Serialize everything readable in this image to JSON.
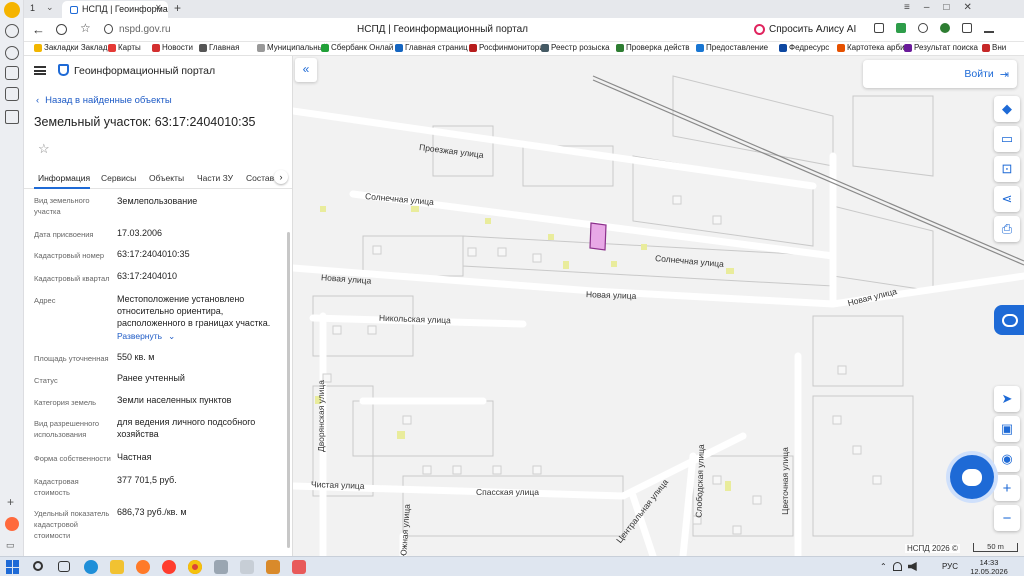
{
  "browser": {
    "tab_count": "1",
    "active_tab_title": "НСПД | Геоинформац",
    "new_tab": "+",
    "url": "nspd.gov.ru",
    "page_title": "НСПД | Геоинформационный портал",
    "alice_label": "Спросить Алису AI",
    "bookmarks": [
      "Закладки Закладк",
      "Карты",
      "Новости",
      "Главная",
      "Муниципальный",
      "Сбербанк Онлай",
      "Главная страниц",
      "Росфинмониторин",
      "Реестр розыска",
      "Проверка действ",
      "Предоставление",
      "Федресурс",
      "Картотека арбит",
      "Результат поиска",
      "Вни"
    ],
    "bookmark_colors": [
      "#f2b600",
      "#e53935",
      "#d32f2f",
      "#555555",
      "#999999",
      "#21a038",
      "#1565c0",
      "#b71c1c",
      "#455a64",
      "#2e7d32",
      "#1976d2",
      "#0d47a1",
      "#e65100",
      "#6a1b9a",
      "#c62828"
    ]
  },
  "panel": {
    "portal_title": "Геоинформационный портал",
    "back_link": "Назад в найденные объекты",
    "object_title": "Земельный участок: 63:17:2404010:35",
    "tabs": [
      "Информация",
      "Сервисы",
      "Объекты",
      "Части ЗУ",
      "Состав"
    ],
    "expand_label": "Развернуть",
    "rows": [
      {
        "label": "Вид земельного участка",
        "value": "Землепользование"
      },
      {
        "label": "Дата присвоения",
        "value": "17.03.2006"
      },
      {
        "label": "Кадастровый номер",
        "value": "63:17:2404010:35"
      },
      {
        "label": "Кадастровый квартал",
        "value": "63:17:2404010"
      },
      {
        "label": "Адрес",
        "value": "Местоположение установлено относительно ориентира, расположенного в границах участка."
      },
      {
        "label": "Площадь уточненная",
        "value": "550 кв. м"
      },
      {
        "label": "Статус",
        "value": "Ранее учтенный"
      },
      {
        "label": "Категория земель",
        "value": "Земли населенных пунктов"
      },
      {
        "label": "Вид разрешенного использования",
        "value": "для ведения личного подсобного хозяйства"
      },
      {
        "label": "Форма собственности",
        "value": "Частная"
      },
      {
        "label": "Кадастровая стоимость",
        "value": "377 701,5 руб."
      },
      {
        "label": "Удельный показатель кадастровой стоимости",
        "value": "686,73 руб./кв. м"
      }
    ]
  },
  "map": {
    "login_label": "Войти",
    "streets": [
      "Проезжая улица",
      "Солнечная улица",
      "Солнечная улица",
      "Новая улица",
      "Новая улица",
      "Новая улица",
      "Никольская улица",
      "Дворянская улица",
      "Чистая улица",
      "Спасская улица",
      "Центральная улица",
      "Слободская улица",
      "Цветочная улица",
      "Южная улица"
    ],
    "copyright": "НСПД 2026 ©",
    "scale": "50 m"
  },
  "taskbar": {
    "lang": "РУС",
    "time": "14:33",
    "date": "12.05.2026"
  }
}
